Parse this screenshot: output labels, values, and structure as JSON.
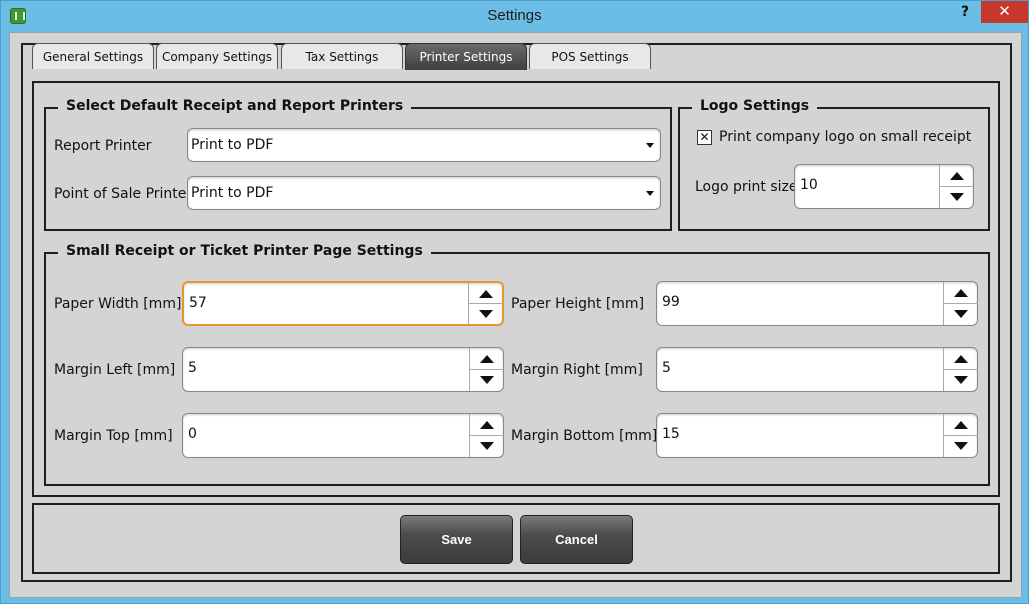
{
  "window": {
    "title": "Settings",
    "help_label": "?",
    "close_label": "✕"
  },
  "tabs": [
    {
      "label": "General Settings",
      "active": false
    },
    {
      "label": "Company Settings",
      "active": false
    },
    {
      "label": "Tax Settings",
      "active": false
    },
    {
      "label": "Printer Settings",
      "active": true
    },
    {
      "label": "POS Settings",
      "active": false
    }
  ],
  "printers_group": {
    "title": "Select Default Receipt and Report Printers",
    "report_printer": {
      "label": "Report Printer",
      "value": "Print to PDF"
    },
    "pos_printer": {
      "label": "Point of Sale Printer",
      "value": "Print to PDF"
    }
  },
  "logo_group": {
    "title": "Logo Settings",
    "print_logo": {
      "label": "Print company logo on small receipt",
      "checked": true,
      "mark": "✕"
    },
    "logo_size": {
      "label": "Logo print size",
      "value": "10"
    }
  },
  "page_group": {
    "title": "Small Receipt or Ticket Printer Page Settings",
    "paper_width": {
      "label": "Paper Width [mm]",
      "value": "57"
    },
    "paper_height": {
      "label": "Paper Height [mm]",
      "value": "99"
    },
    "margin_left": {
      "label": "Margin Left [mm]",
      "value": "5"
    },
    "margin_right": {
      "label": "Margin Right [mm]",
      "value": "5"
    },
    "margin_top": {
      "label": "Margin Top [mm]",
      "value": "0"
    },
    "margin_bottom": {
      "label": "Margin Bottom [mm]",
      "value": "15"
    }
  },
  "buttons": {
    "save": "Save",
    "cancel": "Cancel"
  },
  "colors": {
    "title_bar": "#6cbde6",
    "close_button": "#c7382c",
    "panel": "#d4d4d4",
    "focus_border": "#e8962e"
  }
}
